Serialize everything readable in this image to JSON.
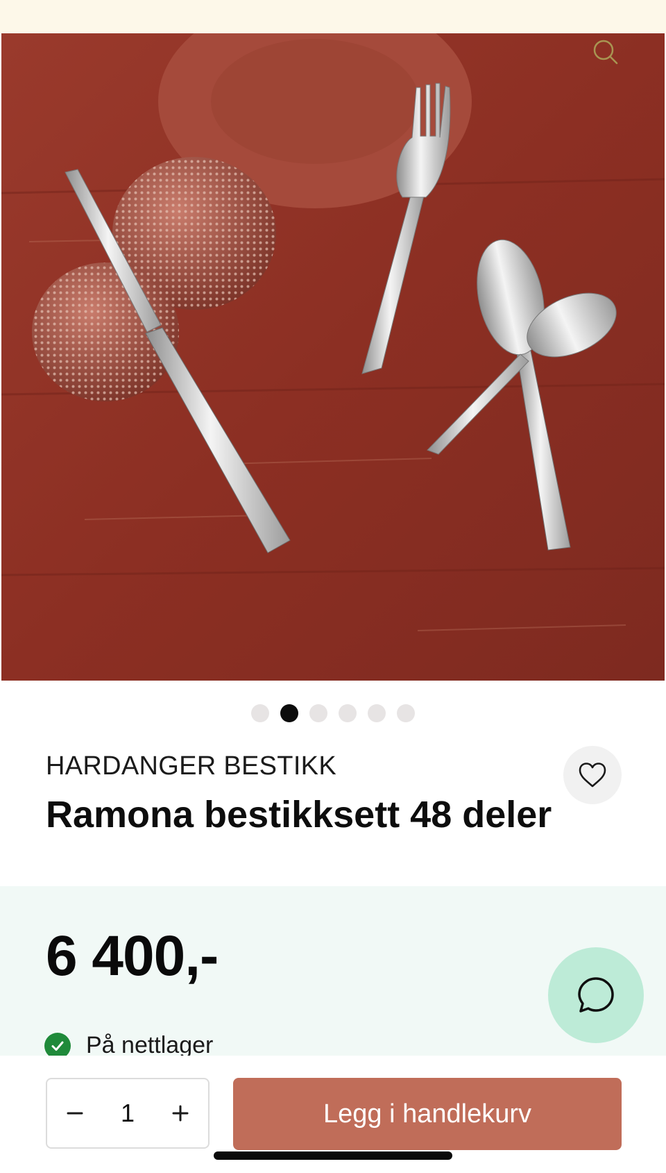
{
  "icons": {
    "zoom": "search-icon",
    "favorite": "heart-icon",
    "chat": "chat-bubble-icon",
    "stock": "check-circle-icon",
    "decrease": "minus-icon",
    "increase": "plus-icon"
  },
  "gallery": {
    "slide_count": 6,
    "active_slide": 2
  },
  "product": {
    "brand": "HARDANGER BESTIKK",
    "title": "Ramona bestikksett 48 deler",
    "price": "6 400,-",
    "stock_status": "På nettlager"
  },
  "cart": {
    "quantity": "1",
    "add_to_cart_label": "Legg i handlekurv"
  },
  "colors": {
    "top_bar": "#fdf8e9",
    "price_panel": "#f1f9f6",
    "cart_button": "#c06d59",
    "chat_button": "#bdebd7",
    "in_stock": "#1f8a3a"
  }
}
